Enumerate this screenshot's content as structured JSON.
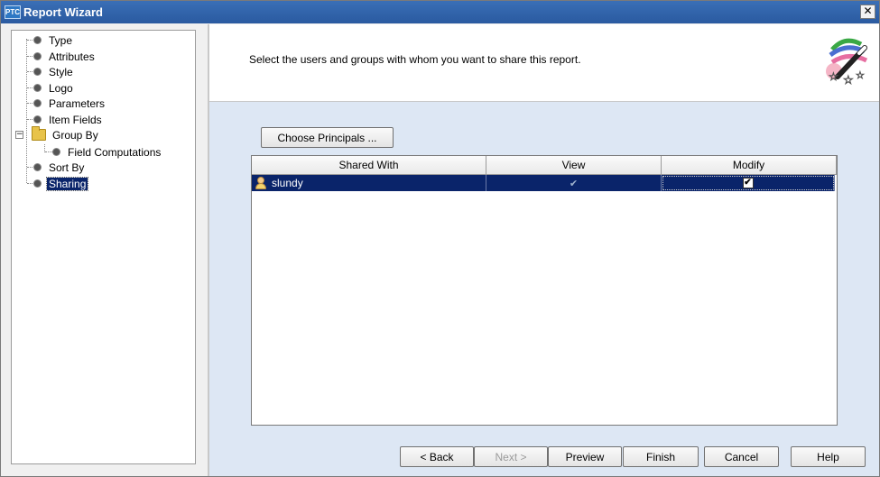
{
  "window": {
    "title": "Report Wizard",
    "logo_text": "PTC",
    "close_glyph": "✕"
  },
  "tree": {
    "items": [
      {
        "label": "Type"
      },
      {
        "label": "Attributes"
      },
      {
        "label": "Style"
      },
      {
        "label": "Logo"
      },
      {
        "label": "Parameters"
      },
      {
        "label": "Item Fields"
      },
      {
        "label": "Group By"
      },
      {
        "label": "Field Computations"
      },
      {
        "label": "Sort By"
      },
      {
        "label": "Sharing"
      }
    ],
    "expander_glyph": "−",
    "selected": "Sharing"
  },
  "header": {
    "instruction": "Select the users and groups with whom you want to share this report.",
    "icon": "magic-wand-icon"
  },
  "choose_principals_label": "Choose Principals ...",
  "table": {
    "columns": [
      "Shared With",
      "View",
      "Modify"
    ],
    "rows": [
      {
        "shared_with": "slundy",
        "view_checked": true,
        "modify_checked": true
      }
    ],
    "view_check_glyph": "✔",
    "modify_check_glyph": "✔"
  },
  "footer": {
    "back_label": "< Back",
    "next_label": "Next >",
    "preview_label": "Preview",
    "finish_label": "Finish",
    "cancel_label": "Cancel",
    "help_label": "Help"
  },
  "colors": {
    "selection": "#0a246a",
    "body_background": "#dde7f4",
    "titlebar": "#2f63aa"
  }
}
